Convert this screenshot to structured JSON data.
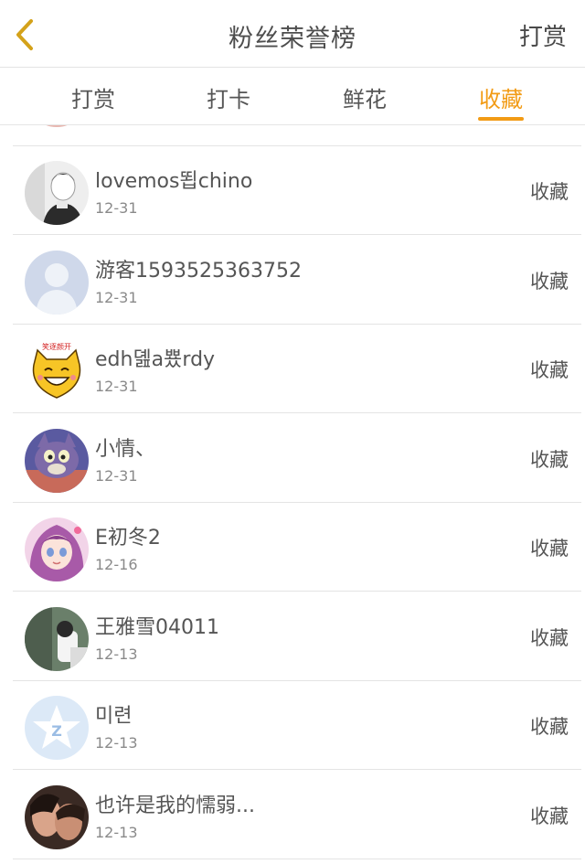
{
  "header": {
    "back_icon": "chevron-left-icon",
    "title": "粉丝荣誉榜",
    "action_label": "打赏"
  },
  "tabs": [
    {
      "label": "打赏",
      "active": false
    },
    {
      "label": "打卡",
      "active": false
    },
    {
      "label": "鲜花",
      "active": false
    },
    {
      "label": "收藏",
      "active": true
    }
  ],
  "colors": {
    "accent": "#f29b15",
    "back_arrow": "#d4a21a"
  },
  "list": [
    {
      "name": "lovemos뙵chino",
      "date": "12-31",
      "action": "收藏",
      "avatar": "bw-portrait"
    },
    {
      "name": "游客1593525363752",
      "date": "12-31",
      "action": "收藏",
      "avatar": "default-user"
    },
    {
      "name": "edh뎶a뿄rdy",
      "date": "12-31",
      "action": "收藏",
      "avatar": "yellow-cat"
    },
    {
      "name": "小情、",
      "date": "12-31",
      "action": "收藏",
      "avatar": "cartoon-cat"
    },
    {
      "name": "E初冬2",
      "date": "12-16",
      "action": "收藏",
      "avatar": "anime-girl"
    },
    {
      "name": "王雅雪04011",
      "date": "12-13",
      "action": "收藏",
      "avatar": "photo"
    },
    {
      "name": "미련",
      "date": "12-13",
      "action": "收藏",
      "avatar": "qq-star"
    },
    {
      "name": "也许是我的懦弱...",
      "date": "12-13",
      "action": "收藏",
      "avatar": "couple"
    }
  ]
}
